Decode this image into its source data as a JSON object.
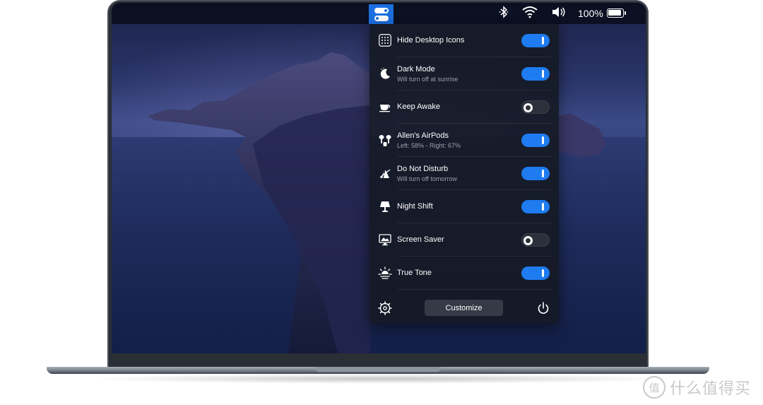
{
  "menubar": {
    "app_icon": "toggles-icon",
    "status_icons": [
      "bluetooth-icon",
      "wifi-icon",
      "volume-icon",
      "battery-icon"
    ],
    "battery_text": "100%"
  },
  "panel": {
    "rows": [
      {
        "icon": "grid-icon",
        "title": "Hide Desktop Icons",
        "subtitle": "",
        "toggle": "on"
      },
      {
        "icon": "moon-icon",
        "title": "Dark Mode",
        "subtitle": "Will turn off at sunrise",
        "toggle": "on"
      },
      {
        "icon": "coffee-cup-icon",
        "title": "Keep Awake",
        "subtitle": "",
        "toggle": "off"
      },
      {
        "icon": "airpods-icon",
        "title": "Allen's AirPods",
        "subtitle": "Left: 58% - Right: 67%",
        "toggle": "on"
      },
      {
        "icon": "do-not-disturb-icon",
        "title": "Do Not Disturb",
        "subtitle": "Will turn off tomorrow",
        "toggle": "on"
      },
      {
        "icon": "lamp-icon",
        "title": "Night Shift",
        "subtitle": "",
        "toggle": "on"
      },
      {
        "icon": "monitor-icon",
        "title": "Screen Saver",
        "subtitle": "",
        "toggle": "off"
      },
      {
        "icon": "sun-icon",
        "title": "True Tone",
        "subtitle": "",
        "toggle": "on"
      }
    ],
    "footer": {
      "settings_icon": "gear-icon",
      "customize_label": "Customize",
      "power_icon": "power-icon"
    }
  },
  "watermark": {
    "logo_text": "值",
    "text": "什么值得买"
  },
  "colors": {
    "accent": "#1e7bf0",
    "panel_bg": "#161a26"
  }
}
